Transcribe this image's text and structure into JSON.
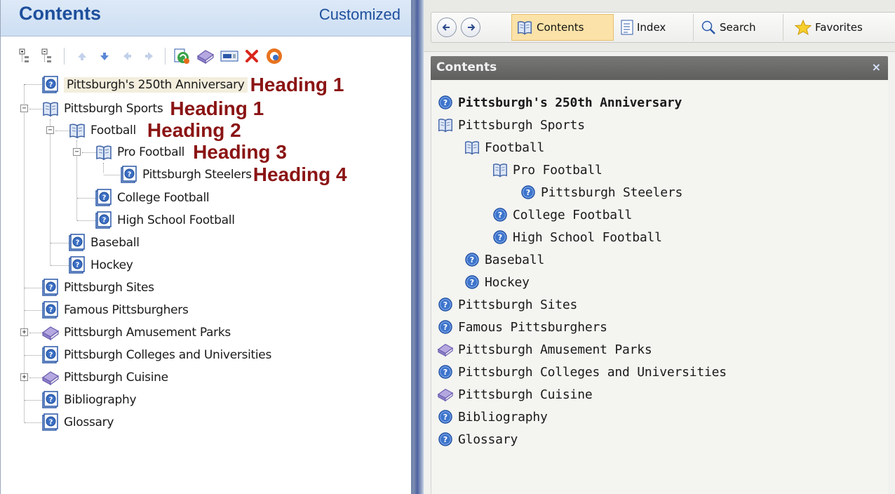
{
  "left_panel": {
    "title": "Contents",
    "subtitle": "Customized",
    "toolbar_icons": [
      "expand-all-icon",
      "collapse-all-icon",
      "move-up-icon",
      "move-down-icon",
      "move-left-icon",
      "move-right-icon",
      "refresh-link-icon",
      "book-icon",
      "topic-list-icon",
      "delete-icon",
      "properties-icon"
    ],
    "tree": [
      {
        "label": "Pittsburgh's 250th Anniversary",
        "icon": "help-topic-icon",
        "heading": "Heading 1"
      },
      {
        "label": "Pittsburgh Sports",
        "icon": "open-book-icon",
        "heading": "Heading 1"
      },
      {
        "label": "Football",
        "icon": "open-book-icon",
        "heading": "Heading 2"
      },
      {
        "label": "Pro Football",
        "icon": "open-book-icon",
        "heading": "Heading 3"
      },
      {
        "label": "Pittsburgh Steelers",
        "icon": "help-topic-icon",
        "heading": "Heading 4"
      },
      {
        "label": "College Football",
        "icon": "help-topic-icon"
      },
      {
        "label": "High School Football",
        "icon": "help-topic-icon"
      },
      {
        "label": "Baseball",
        "icon": "help-topic-icon"
      },
      {
        "label": "Hockey",
        "icon": "help-topic-icon"
      },
      {
        "label": "Pittsburgh Sites",
        "icon": "help-topic-icon"
      },
      {
        "label": "Famous Pittsburghers",
        "icon": "help-topic-icon"
      },
      {
        "label": "Pittsburgh Amusement Parks",
        "icon": "closed-book-icon"
      },
      {
        "label": "Pittsburgh Colleges and Universities",
        "icon": "help-topic-icon"
      },
      {
        "label": "Pittsburgh Cuisine",
        "icon": "closed-book-icon"
      },
      {
        "label": "Bibliography",
        "icon": "help-topic-icon"
      },
      {
        "label": "Glossary",
        "icon": "help-topic-icon"
      }
    ]
  },
  "right_panel": {
    "toolbar": {
      "back_icon": "back-arrow-icon",
      "forward_icon": "forward-arrow-icon",
      "tabs": [
        "Contents",
        "Index",
        "Search",
        "Favorites"
      ]
    },
    "contents_header": {
      "title": "Contents",
      "close": "×"
    },
    "tree": [
      {
        "label": "Pittsburgh's 250th Anniversary",
        "icon": "help-circle-icon"
      },
      {
        "label": "Pittsburgh Sports",
        "icon": "open-book-icon"
      },
      {
        "label": "Football",
        "icon": "open-book-icon"
      },
      {
        "label": "Pro Football",
        "icon": "open-book-icon"
      },
      {
        "label": "Pittsburgh Steelers",
        "icon": "help-circle-icon"
      },
      {
        "label": "College Football",
        "icon": "help-circle-icon"
      },
      {
        "label": "High School Football",
        "icon": "help-circle-icon"
      },
      {
        "label": "Baseball",
        "icon": "help-circle-icon"
      },
      {
        "label": "Hockey",
        "icon": "help-circle-icon"
      },
      {
        "label": "Pittsburgh Sites",
        "icon": "help-circle-icon"
      },
      {
        "label": "Famous Pittsburghers",
        "icon": "help-circle-icon"
      },
      {
        "label": "Pittsburgh Amusement Parks",
        "icon": "closed-book-icon"
      },
      {
        "label": "Pittsburgh Colleges and Universities",
        "icon": "help-circle-icon"
      },
      {
        "label": "Pittsburgh Cuisine",
        "icon": "closed-book-icon"
      },
      {
        "label": "Bibliography",
        "icon": "help-circle-icon"
      },
      {
        "label": "Glossary",
        "icon": "help-circle-icon"
      }
    ]
  },
  "colors": {
    "heading_label": "#8b1414",
    "left_title": "#1e4f9c",
    "active_tab": "#fbe2a8",
    "panel_header": "#6b6b6a"
  }
}
